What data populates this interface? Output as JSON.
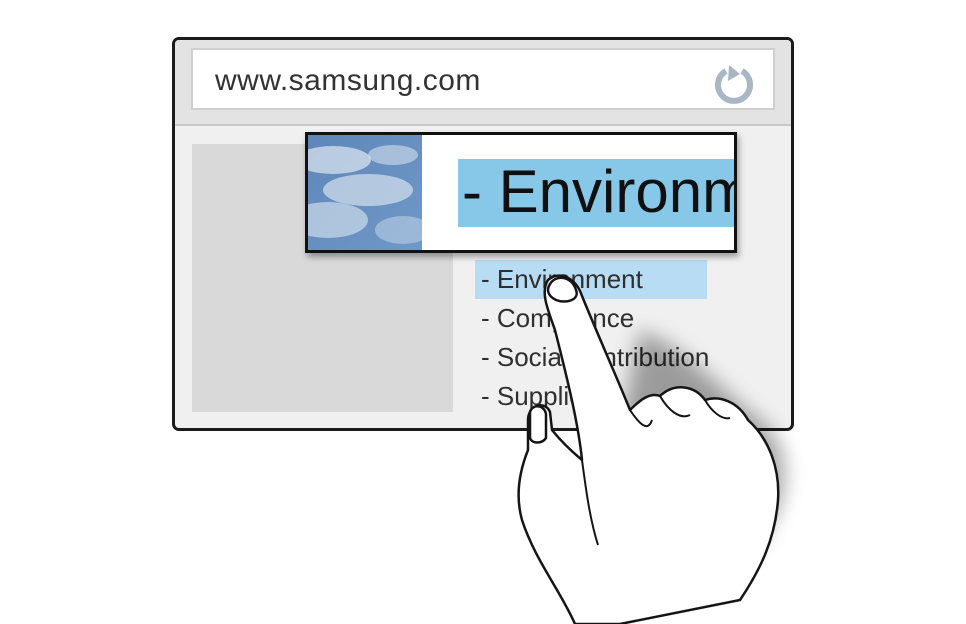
{
  "browser": {
    "url": "www.samsung.com",
    "reload_icon": "reload-icon"
  },
  "magnifier": {
    "text": "- Environm"
  },
  "menu": {
    "items": [
      {
        "label": "- Environment"
      },
      {
        "label": "- Compliance"
      },
      {
        "label": "- Social contribution"
      },
      {
        "label": "- Supplier"
      }
    ]
  },
  "colors": {
    "selection": "#b7dcf3",
    "magnifier_highlight": "#87c8e8",
    "reload_icon": "#a9b6c4"
  }
}
